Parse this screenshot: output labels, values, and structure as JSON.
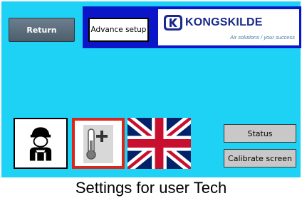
{
  "toolbar": {
    "return_label": "Return",
    "advance_label": "Advance setup"
  },
  "logo": {
    "brand": "KONGSKILDE",
    "tagline": "Air solutions / your success"
  },
  "tiles": [
    {
      "icon": "user-icon"
    },
    {
      "icon": "thermometer-plus-icon",
      "selected": true
    },
    {
      "icon": "uk-flag-icon"
    }
  ],
  "buttons": {
    "status_label": "Status",
    "calibrate_label": "Calibrate screen"
  },
  "caption": "Settings for user Tech",
  "colors": {
    "screen_bg": "#1ed2f5",
    "band": "#0a16c8",
    "selected_border": "#d9261c",
    "brand": "#1b2a8a"
  }
}
